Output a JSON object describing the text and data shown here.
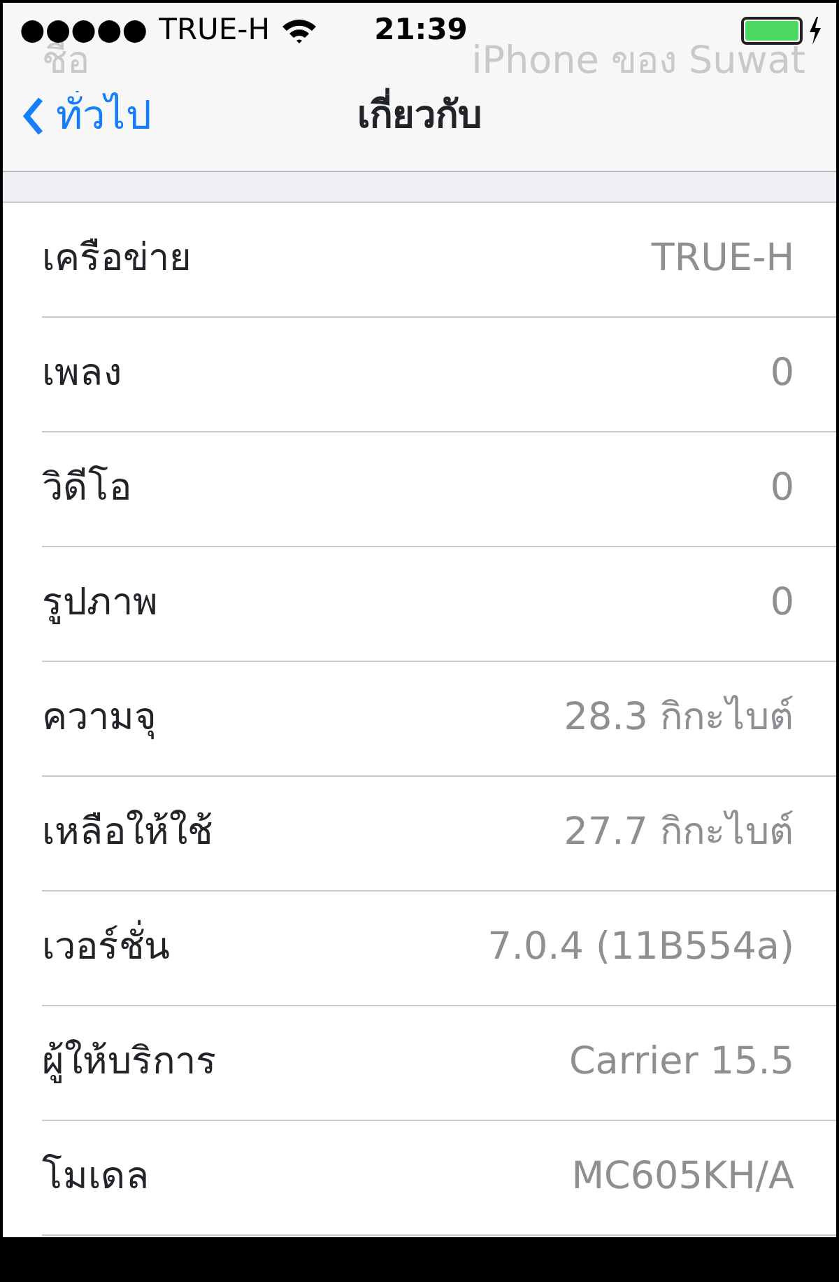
{
  "status_bar": {
    "signal_dots": "●●●●●",
    "carrier": "TRUE-H",
    "time": "21:39",
    "charging": true
  },
  "behind_bar_row": {
    "label": "ชื่อ",
    "value": "iPhone ของ Suwat"
  },
  "nav_bar": {
    "back": "ทั่วไป",
    "title": "เกี่ยวกับ"
  },
  "rows": [
    {
      "label": "เครือข่าย",
      "value": "TRUE-H"
    },
    {
      "label": "เพลง",
      "value": "0"
    },
    {
      "label": "วิดีโอ",
      "value": "0"
    },
    {
      "label": "รูปภาพ",
      "value": "0"
    },
    {
      "label": "ความจุ",
      "value": "28.3 กิกะไบต์"
    },
    {
      "label": "เหลือให้ใช้",
      "value": "27.7 กิกะไบต์"
    },
    {
      "label": "เวอร์ชั่น",
      "value": "7.0.4 (11B554a)"
    },
    {
      "label": "ผู้ให้บริการ",
      "value": "Carrier 15.5"
    },
    {
      "label": "โมเดล",
      "value": "MC605KH/A"
    }
  ]
}
